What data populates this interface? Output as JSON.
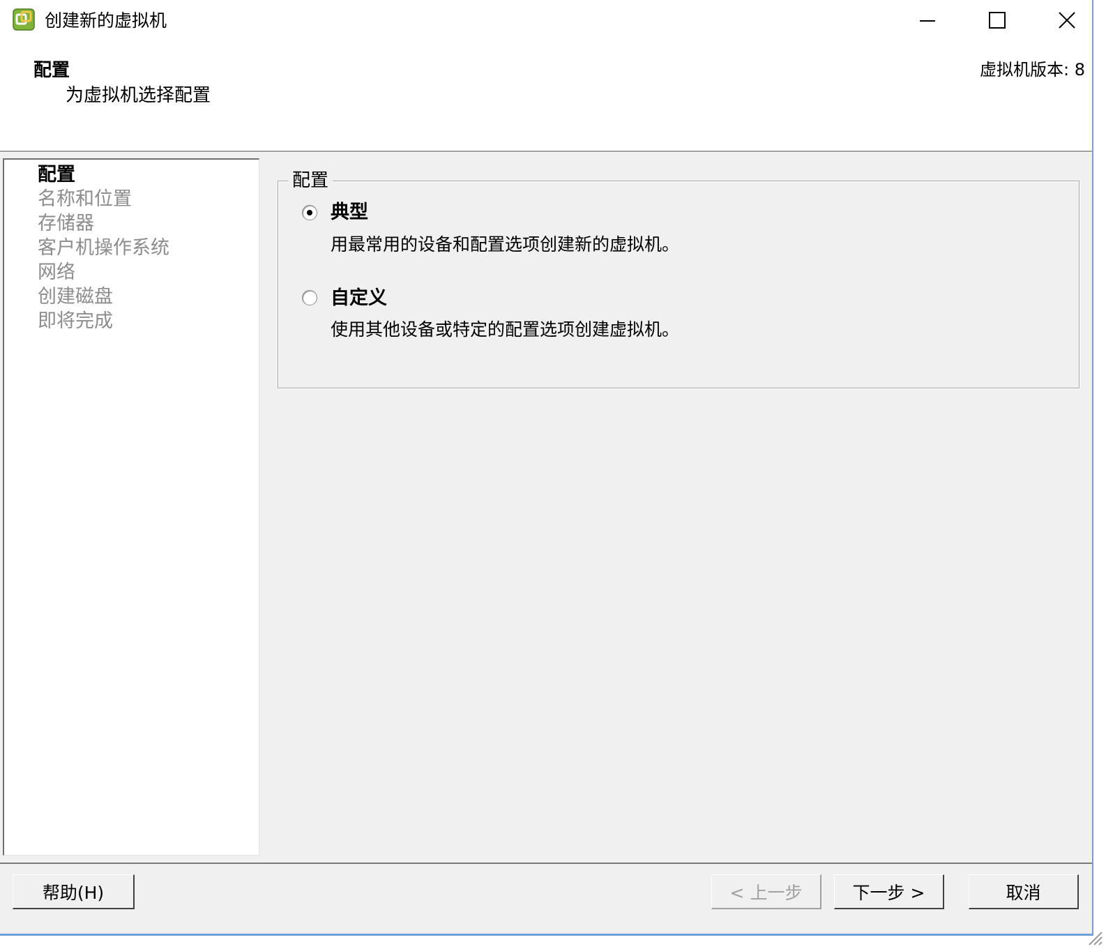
{
  "window": {
    "title": "创建新的虚拟机",
    "app_icon": "vsphere-client-icon",
    "controls": {
      "minimize": "minimize-icon",
      "maximize": "maximize-icon",
      "close": "close-icon"
    }
  },
  "header": {
    "title": "配置",
    "subtitle": "为虚拟机选择配置",
    "version_label": "虚拟机版本: 8"
  },
  "steps": [
    {
      "label": "配置",
      "active": true
    },
    {
      "label": "名称和位置",
      "active": false
    },
    {
      "label": "存储器",
      "active": false
    },
    {
      "label": "客户机操作系统",
      "active": false
    },
    {
      "label": "网络",
      "active": false
    },
    {
      "label": "创建磁盘",
      "active": false
    },
    {
      "label": "即将完成",
      "active": false
    }
  ],
  "config": {
    "group_label": "配置",
    "options": [
      {
        "title": "典型",
        "description": "用最常用的设备和配置选项创建新的虚拟机。",
        "selected": true
      },
      {
        "title": "自定义",
        "description": "使用其他设备或特定的配置选项创建虚拟机。",
        "selected": false
      }
    ]
  },
  "footer": {
    "help": "帮助(H)",
    "back": "< 上一步",
    "next": "下一步 >",
    "cancel": "取消"
  },
  "colors": {
    "accent_border": "#6f9fd8",
    "panel_bg": "#f0f0f0",
    "disabled_text": "#a0a0a0"
  }
}
